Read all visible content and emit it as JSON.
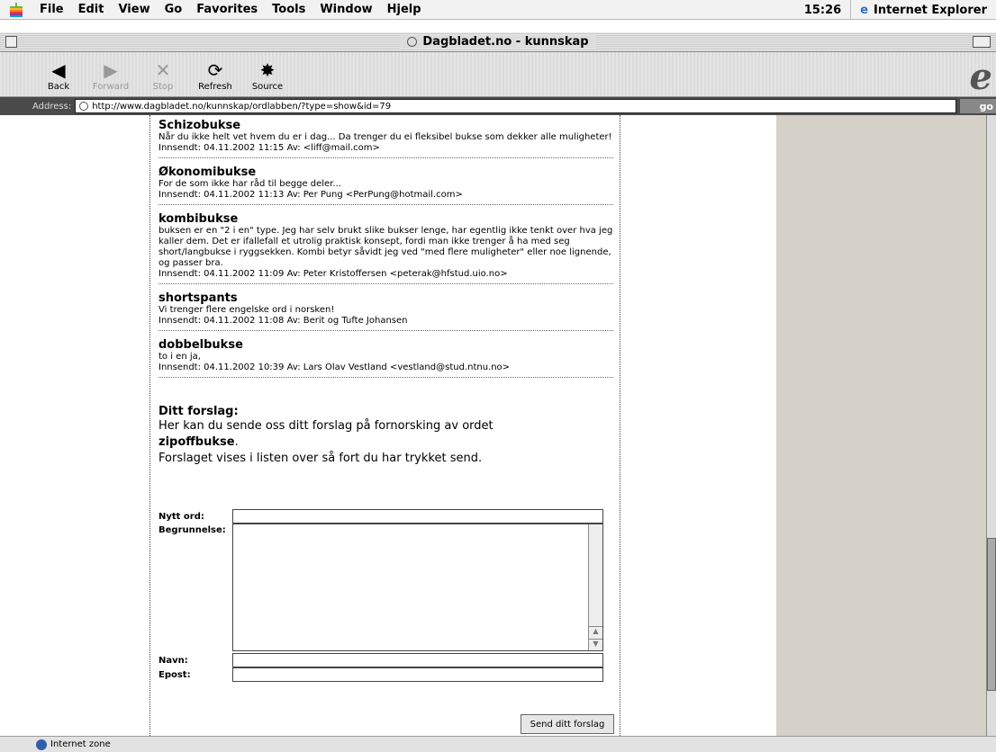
{
  "menubar": {
    "items": [
      "File",
      "Edit",
      "View",
      "Go",
      "Favorites",
      "Tools",
      "Window",
      "Hjelp"
    ],
    "clock": "15:26",
    "app_name": "Internet Explorer"
  },
  "window": {
    "title": "Dagbladet.no - kunnskap"
  },
  "toolbar": {
    "back": "Back",
    "forward": "Forward",
    "stop": "Stop",
    "refresh": "Refresh",
    "source": "Source"
  },
  "address": {
    "label": "Address:",
    "url": "http://www.dagbladet.no/kunnskap/ordlabben/?type=show&id=79",
    "go": "go"
  },
  "entries": [
    {
      "word": "Schizobukse",
      "text": "Når du ikke helt vet hvem du er i dag... Da trenger du ei fleksibel bukse som dekker alle muligheter!",
      "meta": "Innsendt: 04.11.2002 11:15 Av: <liff@mail.com>"
    },
    {
      "word": "Økonomibukse",
      "text": "For de som ikke har råd til begge deler...",
      "meta": "Innsendt: 04.11.2002 11:13 Av: Per Pung <PerPung@hotmail.com>"
    },
    {
      "word": "kombibukse",
      "text": "buksen er en \"2 i en\" type. Jeg har selv brukt slike bukser lenge, har egentlig ikke tenkt over hva jeg kaller dem. Det er ifallefall et utrolig praktisk konsept, fordi man ikke trenger å ha med seg short/langbukse i ryggsekken. Kombi betyr såvidt jeg ved \"med flere muligheter\" eller noe lignende, og passer bra.",
      "meta": "Innsendt: 04.11.2002 11:09 Av: Peter Kristoffersen <peterak@hfstud.uio.no>"
    },
    {
      "word": "shortspants",
      "text": "Vi trenger flere engelske ord i norsken!",
      "meta": "Innsendt: 04.11.2002 11:08 Av: Berit og Tufte Johansen"
    },
    {
      "word": "dobbelbukse",
      "text": "to i en ja,",
      "meta": "Innsendt: 04.11.2002 10:39 Av: Lars Olav Vestland <vestland@stud.ntnu.no>"
    }
  ],
  "form": {
    "heading": "Ditt forslag:",
    "intro_1": "Her kan du sende oss ditt forslag på fornorsking av ordet",
    "word": "zipoffbukse",
    "intro_dot": ".",
    "intro_2": "Forslaget vises i listen over så fort du har trykket send.",
    "label_word": "Nytt ord:",
    "label_reason": "Begrunnelse:",
    "label_name": "Navn:",
    "label_email": "Epost:",
    "submit": "Send ditt forslag"
  },
  "status": {
    "zone": "Internet zone"
  }
}
